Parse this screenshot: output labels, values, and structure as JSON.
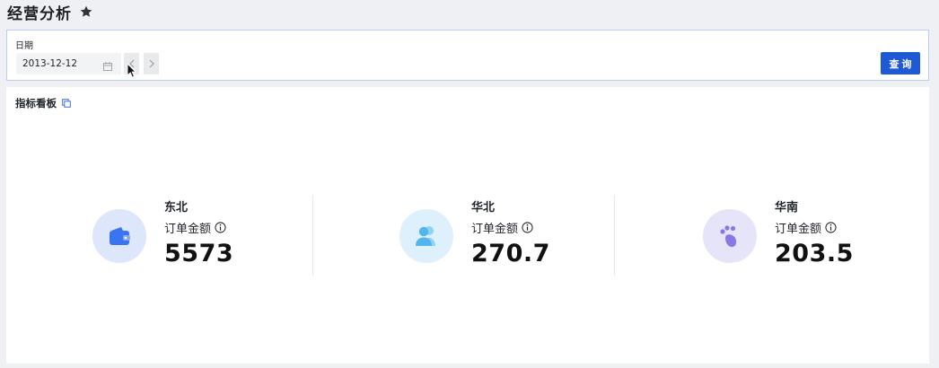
{
  "header": {
    "title": "经营分析"
  },
  "filter": {
    "date_label": "日期",
    "date_value": "2013-12-12",
    "query_label": "查询"
  },
  "board": {
    "title": "指标看板",
    "cards": [
      {
        "region": "东北",
        "metric_label": "订单金额",
        "value": "5573",
        "icon": "wallet-icon",
        "circle_color": "#dde6fb",
        "icon_color": "#3b74f1"
      },
      {
        "region": "华北",
        "metric_label": "订单金额",
        "value": "270.7",
        "icon": "users-icon",
        "circle_color": "#def0fb",
        "icon_color": "#52b6ea"
      },
      {
        "region": "华南",
        "metric_label": "订单金额",
        "value": "203.5",
        "icon": "paw-icon",
        "circle_color": "#e6e4f8",
        "icon_color": "#8b77e3"
      }
    ]
  },
  "colors": {
    "accent": "#1f5ad6",
    "panel_border": "#b9cdf5",
    "background": "#eef0f3"
  }
}
